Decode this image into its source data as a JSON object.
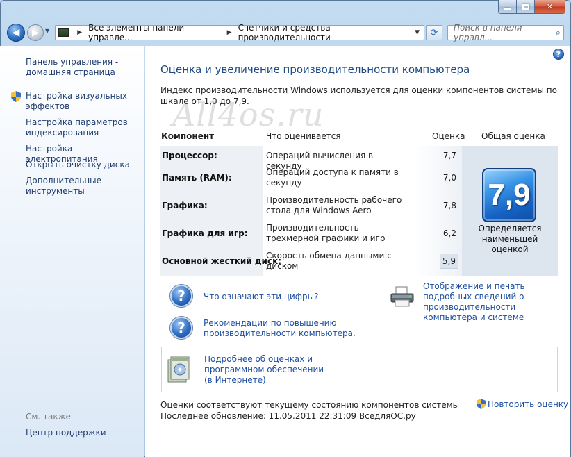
{
  "window": {
    "min_glyph": "",
    "max_glyph": "",
    "close_glyph": "✕"
  },
  "nav": {
    "back_glyph": "◀",
    "forward_glyph": "▶",
    "history_glyph": "▼",
    "breadcrumb": [
      "Все элементы панели управле...",
      "Счетчики и средства производительности"
    ],
    "sep_glyph": "▶",
    "drop_glyph": "▼",
    "refresh_glyph": "⟳",
    "search_placeholder": "Поиск в панели управл...",
    "search_glyph": "⌕"
  },
  "sidebar": {
    "home": "Панель управления - домашняя страница",
    "items": [
      "Настройка визуальных эффектов",
      "Настройка параметров индексирования",
      "Настройка электропитания",
      "Открыть очистку диска",
      "Дополнительные инструменты"
    ],
    "see_also": "См. также",
    "support": "Центр поддержки"
  },
  "main": {
    "help_glyph": "?",
    "title": "Оценка и увеличение производительности компьютера",
    "intro": "Индекс производительности Windows используется для оценки компонентов системы по шкале от 1,0 до 7,9.",
    "watermark": "All4os.ru",
    "table": {
      "headers": {
        "component": "Компонент",
        "what": "Что оценивается",
        "score": "Оценка",
        "total": "Общая оценка"
      },
      "rows": [
        {
          "name": "Процессор:",
          "desc": "Операций вычисления в секунду",
          "score": "7,7"
        },
        {
          "name": "Память (RAM):",
          "desc": "Операций доступа к памяти в секунду",
          "score": "7,0"
        },
        {
          "name": "Графика:",
          "desc": "Производительность рабочего стола для Windows Aero",
          "score": "7,8"
        },
        {
          "name": "Графика для игр:",
          "desc": "Производительность трехмерной графики и игр",
          "score": "6,2"
        },
        {
          "name": "Основной жесткий диск:",
          "desc": "Скорость обмена данными с диском",
          "score": "5,9"
        }
      ],
      "base_score": "7,9",
      "base_caption": "Определяется наименьшей оценкой"
    },
    "links": {
      "q_glyph": "?",
      "what_numbers": "Что означают эти цифры?",
      "tips": "Рекомендации по повышению производительности компьютера.",
      "print_details": "Отображение и печать подробных сведений о производительности компьютера и системе",
      "more_info": "Подробнее об оценках и программном обеспечении (в Интернете)"
    },
    "status": {
      "current": "Оценки соответствуют текущему состоянию компонентов системы",
      "last_update": "Последнее обновление: 11.05.2011 22:31:09 ВседляОС.ру",
      "rerun": "Повторить оценку"
    }
  }
}
